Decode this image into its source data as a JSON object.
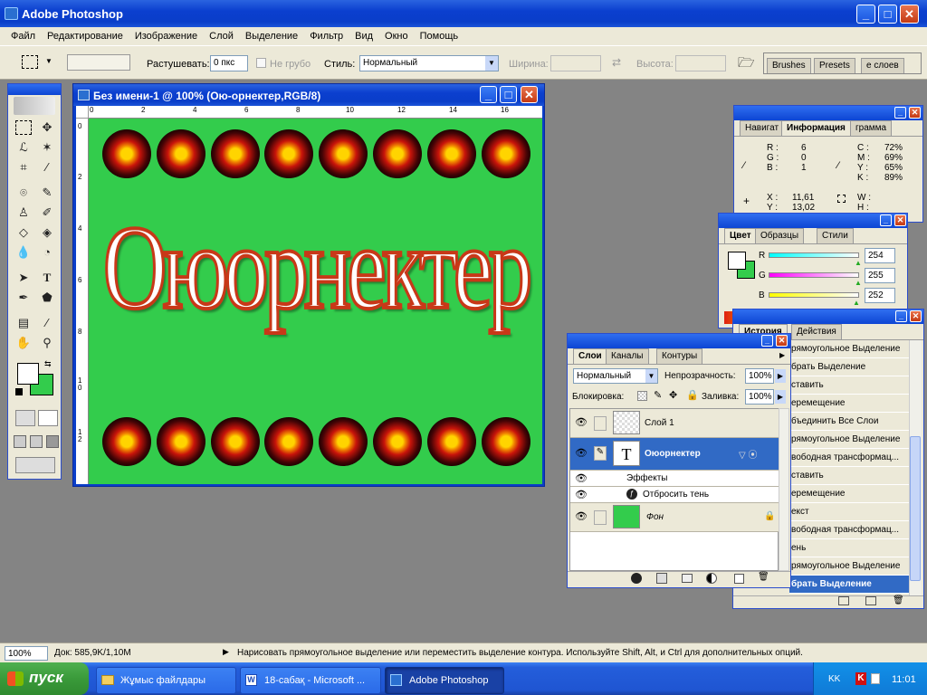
{
  "app": {
    "title": "Adobe Photoshop"
  },
  "menu": [
    "Файл",
    "Редактирование",
    "Изображение",
    "Слой",
    "Выделение",
    "Фильтр",
    "Вид",
    "Окно",
    "Помощь"
  ],
  "options": {
    "feather_label": "Растушевать:",
    "feather_value": "0 пкс",
    "antialias_label": "Не грубо",
    "style_label": "Стиль:",
    "style_value": "Нормальный",
    "width_label": "Ширина:",
    "height_label": "Высота:",
    "palette_tabs": [
      "Brushes",
      "Presets",
      "е слоев"
    ]
  },
  "doc": {
    "title": "Без имени-1 @ 100% (Ою-орнектер,RGB/8)",
    "text": "Оюорнектер",
    "canvas_color": "#33cc4c",
    "ruler_h": [
      "0",
      "2",
      "4",
      "6",
      "8",
      "10",
      "12",
      "14",
      "16"
    ],
    "ruler_v": [
      "0",
      "2",
      "4",
      "6",
      "8",
      "1\n0",
      "1\n2"
    ]
  },
  "info": {
    "tabs": [
      "Навигат",
      "Информация",
      "грамма"
    ],
    "rgb": [
      {
        "k": "R :",
        "v": "6"
      },
      {
        "k": "G :",
        "v": "0"
      },
      {
        "k": "B :",
        "v": "1"
      }
    ],
    "cmyk": [
      {
        "k": "C :",
        "v": "72%"
      },
      {
        "k": "M :",
        "v": "69%"
      },
      {
        "k": "Y :",
        "v": "65%"
      },
      {
        "k": "K :",
        "v": "89%"
      }
    ],
    "xy": [
      {
        "k": "X :",
        "v": "11,61"
      },
      {
        "k": "Y :",
        "v": "13,02"
      }
    ],
    "wh": [
      {
        "k": "W :",
        "v": ""
      },
      {
        "k": "H :",
        "v": ""
      }
    ]
  },
  "color": {
    "tabs": [
      "Цвет",
      "Образцы",
      "Стили"
    ],
    "r_label": "R",
    "r_value": "254",
    "g_label": "G",
    "g_value": "255",
    "b_label": "B",
    "b_value": "252"
  },
  "history": {
    "tabs": [
      "История",
      "Действия"
    ],
    "items": [
      "рямоугольное Выделение",
      "брать Выделение",
      "ставить",
      "еремещение",
      "бъединить Все Слои",
      "рямоугольное Выделение",
      "вободная трансформац...",
      "ставить",
      "еремещение",
      "екст",
      "вободная трансформац...",
      "ень",
      "рямоугольное Выделение",
      "брать Выделение"
    ]
  },
  "layers": {
    "tabs": [
      "Слои",
      "Каналы",
      "Контуры"
    ],
    "blend_mode": "Нормальный",
    "opacity_label": "Непрозрачность:",
    "opacity_value": "100%",
    "lock_label": "Блокировка:",
    "fill_label": "Заливка:",
    "fill_value": "100%",
    "items": [
      "Слой 1",
      "Оюорнектер",
      "Эффекты",
      "Отбросить тень",
      "Фон"
    ],
    "text_thumb": "T"
  },
  "status": {
    "zoom": "100%",
    "doc_size": "Док: 585,9K/1,10M",
    "hint": "Нарисовать прямоугольное выделение или переместить выделение контура.  Используйте Shift, Alt, и Ctrl для дополнительных опций."
  },
  "taskbar": {
    "start": "пуск",
    "items": [
      "Жұмыс файлдары",
      "18-сабақ - Microsoft ...",
      "Adobe Photoshop"
    ],
    "lang": "KK",
    "clock": "11:01"
  },
  "colors": {
    "accent": "#0a3ec9",
    "canvas": "#33cc4c",
    "text_fill": "#ffffff",
    "text_stroke": "#c83818",
    "fg_color": "#ffffff",
    "bg_color": "#33cc4c"
  }
}
